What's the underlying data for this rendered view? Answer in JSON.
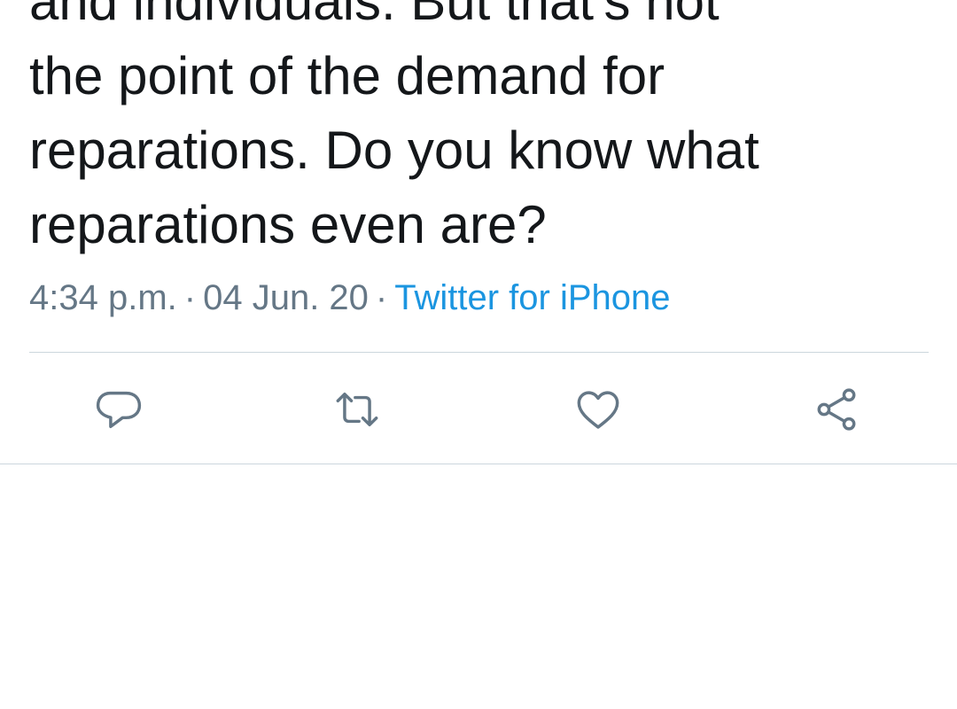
{
  "tweet": {
    "text_lines": [
      "and individuals. But that's not",
      "the point of the demand for",
      "reparations. Do you know what",
      "reparations even are?"
    ],
    "time": "4:34 p.m.",
    "separator": "·",
    "date": "04 Jun. 20",
    "source": "Twitter for iPhone"
  },
  "actions": {
    "reply_icon": "reply-icon",
    "retweet_icon": "retweet-icon",
    "like_icon": "heart-icon",
    "share_icon": "share-icon"
  },
  "colors": {
    "text": "#14171a",
    "meta": "#657786",
    "link": "#1b95e0",
    "icon": "#657786",
    "divider": "#ccd6dd"
  }
}
